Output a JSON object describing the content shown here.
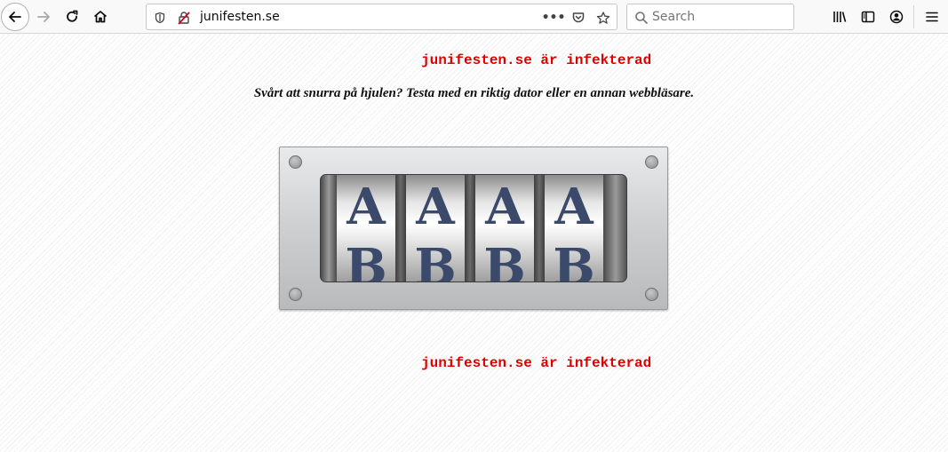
{
  "browser": {
    "url": "junifesten.se",
    "search_placeholder": "Search"
  },
  "page": {
    "infected_top": "junifesten.se är infekterad",
    "subtitle": "Svårt att snurra på hjulen? Testa med en riktig dator eller en annan webbläsare.",
    "infected_bottom": "junifesten.se är infekterad",
    "reels": [
      {
        "top": "A",
        "bottom": "B"
      },
      {
        "top": "A",
        "bottom": "B"
      },
      {
        "top": "A",
        "bottom": "B"
      },
      {
        "top": "A",
        "bottom": "B"
      }
    ]
  }
}
